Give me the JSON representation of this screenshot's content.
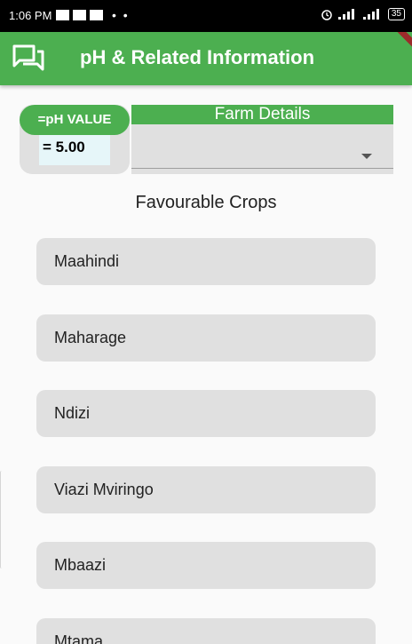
{
  "status_bar": {
    "time": "1:06 PM",
    "dots": "• •",
    "battery": "35"
  },
  "app_bar": {
    "title": "pH & Related Information"
  },
  "ph": {
    "label": "=pH VALUE",
    "value": "= 5.00"
  },
  "farm": {
    "header": "Farm Details",
    "selected": ""
  },
  "crops": {
    "title": "Favourable Crops",
    "items": [
      "Maahindi",
      "Maharage",
      "Ndizi",
      "Viazi Mviringo",
      "Mbaazi",
      "Mtama"
    ]
  },
  "colors": {
    "accent": "#4caf50",
    "card": "#e0e0e0",
    "status_bar": "#000000"
  },
  "icons": {
    "app_bar": "chat-icon",
    "dropdown": "dropdown-arrow-icon"
  }
}
